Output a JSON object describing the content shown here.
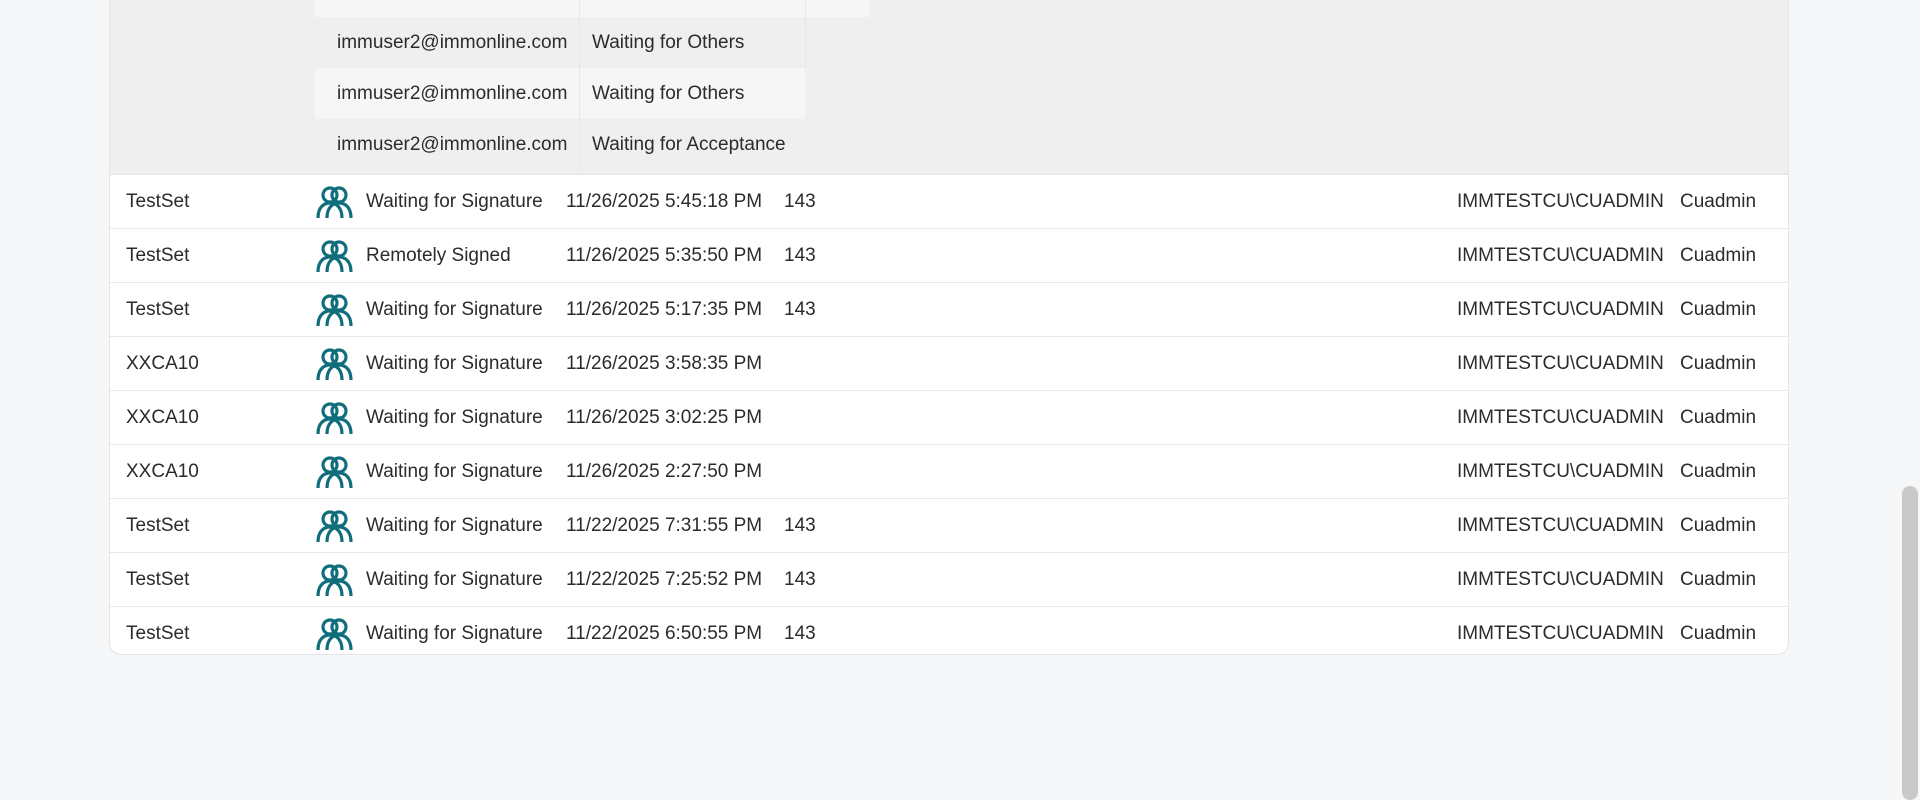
{
  "colors": {
    "icon_accent": "#0f6d7c",
    "panel_bg": "#ffffff",
    "detail_bg": "#efefef",
    "scroll_thumb": "#c9c9c9"
  },
  "detail_rows": [
    {
      "email": "",
      "status": ""
    },
    {
      "email": "immuser2@immonline.com",
      "status": "Waiting for Others"
    },
    {
      "email": "immuser2@immonline.com",
      "status": "Waiting for Others"
    },
    {
      "email": "immuser2@immonline.com",
      "status": "Waiting for Acceptance"
    }
  ],
  "rows": [
    {
      "name": "TestSet",
      "icon": "group-icon",
      "status": "Waiting for Signature",
      "date": "11/26/2025 5:45:18 PM",
      "number": "143",
      "user": "IMMTESTCU\\CUADMIN",
      "owner": "Cuadmin"
    },
    {
      "name": "TestSet",
      "icon": "group-icon",
      "status": "Remotely Signed",
      "date": "11/26/2025 5:35:50 PM",
      "number": "143",
      "user": "IMMTESTCU\\CUADMIN",
      "owner": "Cuadmin"
    },
    {
      "name": "TestSet",
      "icon": "group-icon",
      "status": "Waiting for Signature",
      "date": "11/26/2025 5:17:35 PM",
      "number": "143",
      "user": "IMMTESTCU\\CUADMIN",
      "owner": "Cuadmin"
    },
    {
      "name": "XXCA10",
      "icon": "group-icon",
      "status": "Waiting for Signature",
      "date": "11/26/2025 3:58:35 PM",
      "number": "",
      "user": "IMMTESTCU\\CUADMIN",
      "owner": "Cuadmin"
    },
    {
      "name": "XXCA10",
      "icon": "group-icon",
      "status": "Waiting for Signature",
      "date": "11/26/2025 3:02:25 PM",
      "number": "",
      "user": "IMMTESTCU\\CUADMIN",
      "owner": "Cuadmin"
    },
    {
      "name": "XXCA10",
      "icon": "group-icon",
      "status": "Waiting for Signature",
      "date": "11/26/2025 2:27:50 PM",
      "number": "",
      "user": "IMMTESTCU\\CUADMIN",
      "owner": "Cuadmin"
    },
    {
      "name": "TestSet",
      "icon": "group-icon",
      "status": "Waiting for Signature",
      "date": "11/22/2025 7:31:55 PM",
      "number": "143",
      "user": "IMMTESTCU\\CUADMIN",
      "owner": "Cuadmin"
    },
    {
      "name": "TestSet",
      "icon": "group-icon",
      "status": "Waiting for Signature",
      "date": "11/22/2025 7:25:52 PM",
      "number": "143",
      "user": "IMMTESTCU\\CUADMIN",
      "owner": "Cuadmin"
    },
    {
      "name": "TestSet",
      "icon": "group-icon",
      "status": "Waiting for Signature",
      "date": "11/22/2025 6:50:55 PM",
      "number": "143",
      "user": "IMMTESTCU\\CUADMIN",
      "owner": "Cuadmin"
    }
  ]
}
